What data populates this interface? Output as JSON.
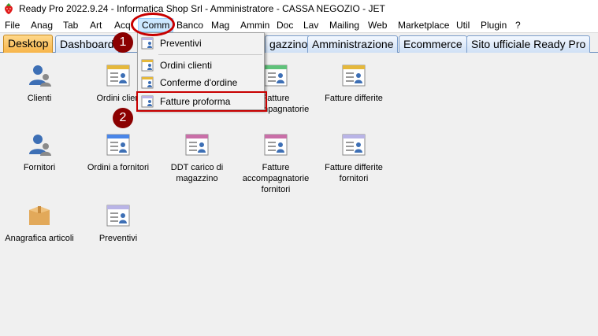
{
  "window": {
    "title": "Ready Pro 2022.9.24 - Informatica Shop Srl - Amministratore - CASSA NEGOZIO - JET"
  },
  "menubar": {
    "file": "File",
    "anag": "Anag",
    "tab": "Tab",
    "art": "Art",
    "acq": "Acq",
    "comm": "Comm",
    "banco": "Banco",
    "mag": "Mag",
    "ammin": "Ammin",
    "doc": "Doc",
    "lav": "Lav",
    "mailing": "Mailing",
    "web": "Web",
    "marketplace": "Marketplace",
    "util": "Util",
    "plugin": "Plugin",
    "help": "?"
  },
  "tabs": {
    "desktop": "Desktop",
    "dashboard": "Dashboard",
    "magazzino": "gazzino",
    "amministrazione": "Amministrazione",
    "ecommerce": "Ecommerce",
    "sito": "Sito ufficiale Ready Pro"
  },
  "dropdown": {
    "preventivi": "Preventivi",
    "ordini_clienti": "Ordini clienti",
    "conferme_ordine": "Conferme d'ordine",
    "fatture_proforma": "Fatture proforma"
  },
  "desktop": {
    "clienti": "Clienti",
    "ordini_clienti": "Ordini clien",
    "fatture_acc": "Fatture\naccompagnatorie",
    "fatture_differite": "Fatture differite",
    "fornitori": "Fornitori",
    "ordini_fornitori": "Ordini a fornitori",
    "ddt_carico": "DDT carico di\nmagazzino",
    "fatture_acc_fornitori": "Fatture\naccompagnatorie\nfornitori",
    "fatture_diff_fornitori": "Fatture differite\nfornitori",
    "anagrafica_articoli": "Anagrafica articoli",
    "preventivi": "Preventivi"
  },
  "callouts": {
    "one": "1",
    "two": "2"
  },
  "colors": {
    "accent_red": "#c80000",
    "callout": "#8b0000",
    "tab_active": "#f7b54a",
    "tab_inactive": "#cfe0f5"
  },
  "icons": [
    "strawberry-icon",
    "person-icon",
    "document-person-icon",
    "box-icon"
  ]
}
